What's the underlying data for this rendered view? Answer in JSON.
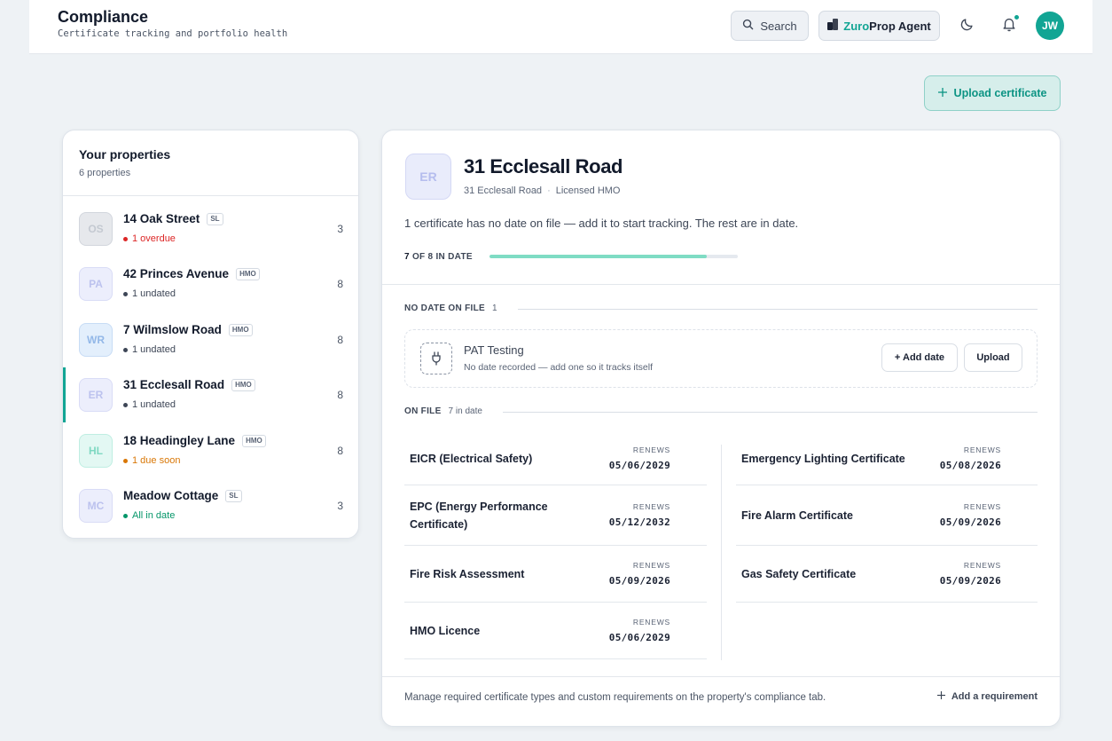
{
  "header": {
    "title": "Compliance",
    "subtitle": "Certificate tracking and portfolio health",
    "search_label": "Search",
    "agent_brand": "Zuro",
    "agent_suffix": "Prop Agent",
    "avatar_initials": "JW"
  },
  "actions": {
    "upload_label": "Upload certificate"
  },
  "properties_panel": {
    "title": "Your properties",
    "count_label": "6 properties",
    "items": [
      {
        "initials": "OS",
        "name": "14 Oak Street",
        "tag": "SL",
        "status": "1 overdue",
        "status_color": "#dc2626",
        "count": "3",
        "avatar_bg": "#e6e8ec",
        "avatar_border": "#d2d6dd",
        "avatar_fg": "#c4c9d1"
      },
      {
        "initials": "PA",
        "name": "42 Princes Avenue",
        "tag": "HMO",
        "status": "1 undated",
        "status_color": "#3d4656",
        "count": "8",
        "avatar_bg": "#eceefc",
        "avatar_border": "#d9dcf6",
        "avatar_fg": "#bcc2ee"
      },
      {
        "initials": "WR",
        "name": "7 Wilmslow Road",
        "tag": "HMO",
        "status": "1 undated",
        "status_color": "#3d4656",
        "count": "8",
        "avatar_bg": "#e3effc",
        "avatar_border": "#c7dcf5",
        "avatar_fg": "#93b8e8"
      },
      {
        "initials": "ER",
        "name": "31 Ecclesall Road",
        "tag": "HMO",
        "status": "1 undated",
        "status_color": "#3d4656",
        "count": "8",
        "avatar_bg": "#eceefc",
        "avatar_border": "#d9dcf6",
        "avatar_fg": "#bcc2ee"
      },
      {
        "initials": "HL",
        "name": "18 Headingley Lane",
        "tag": "HMO",
        "status": "1 due soon",
        "status_color": "#d97706",
        "count": "8",
        "avatar_bg": "#e3f8f3",
        "avatar_border": "#bfeee2",
        "avatar_fg": "#7fd8c2"
      },
      {
        "initials": "MC",
        "name": "Meadow Cottage",
        "tag": "SL",
        "status": "All in date",
        "status_color": "#059669",
        "count": "3",
        "avatar_bg": "#eceefc",
        "avatar_border": "#d9dcf6",
        "avatar_fg": "#bcc2ee"
      }
    ],
    "active_index": 3
  },
  "detail": {
    "initials": "ER",
    "title": "31 Ecclesall Road",
    "address": "31 Ecclesall Road",
    "type": "Licensed HMO",
    "message": "1 certificate has no date on file — add it to start tracking. The rest are in date.",
    "progress_count": "7",
    "progress_suffix": "OF 8 IN DATE",
    "progress_fraction": 0.875,
    "no_date_section": {
      "label": "NO DATE ON FILE",
      "count": "1",
      "item": {
        "title": "PAT Testing",
        "subtitle": "No date recorded — add one so it tracks itself",
        "add_date_label": "+ Add date",
        "upload_label": "Upload"
      }
    },
    "on_file_section": {
      "label": "ON FILE",
      "count": "7 in date",
      "renews_label": "RENEWS",
      "left": [
        {
          "name": "EICR (Electrical Safety)",
          "date": "05/06/2029"
        },
        {
          "name": "EPC (Energy Performance Certificate)",
          "date": "05/12/2032"
        },
        {
          "name": "Fire Risk Assessment",
          "date": "05/09/2026"
        },
        {
          "name": "HMO Licence",
          "date": "05/06/2029"
        }
      ],
      "right": [
        {
          "name": "Emergency Lighting Certificate",
          "date": "05/08/2026"
        },
        {
          "name": "Fire Alarm Certificate",
          "date": "05/09/2026"
        },
        {
          "name": "Gas Safety Certificate",
          "date": "05/09/2026"
        }
      ]
    },
    "footer_text": "Manage required certificate types and custom requirements on the property's compliance tab.",
    "add_requirement_label": "Add a requirement"
  },
  "colors": {
    "accent": "#12a594",
    "overdue": "#dc2626",
    "due_soon": "#d97706",
    "in_date": "#059669"
  }
}
